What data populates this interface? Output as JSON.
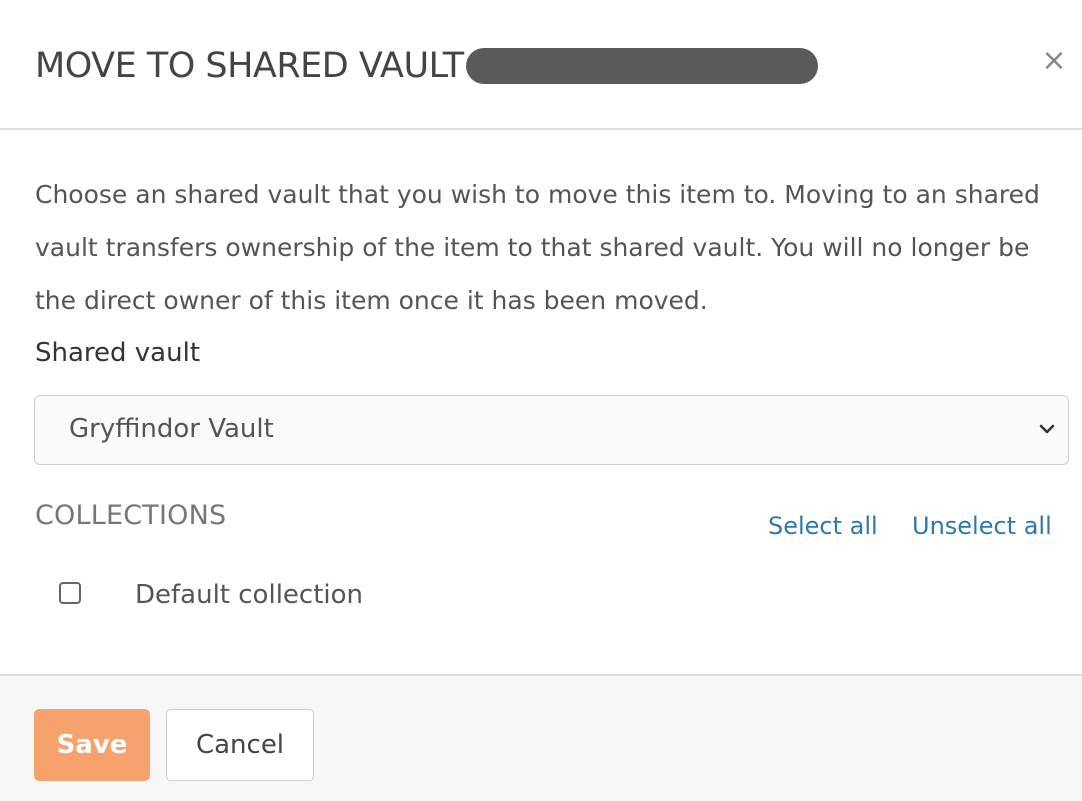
{
  "dialog": {
    "title": "MOVE TO SHARED VAULT",
    "close_label": "×"
  },
  "body": {
    "description": "Choose an shared vault that you wish to move this item to. Moving to an shared vault transfers ownership of the item to that shared vault. You will no longer be the direct owner of this item once it has been moved.",
    "shared_vault_label": "Shared vault",
    "shared_vault_selected": "Gryffindor Vault",
    "collections_heading": "COLLECTIONS",
    "select_all_label": "Select all",
    "unselect_all_label": "Unselect all",
    "collections": [
      {
        "label": "Default collection",
        "checked": false
      }
    ]
  },
  "footer": {
    "save_label": "Save",
    "cancel_label": "Cancel"
  },
  "colors": {
    "accent_save": "#f7a26c",
    "link": "#2a7ab0"
  },
  "icons": {
    "close": "close-icon",
    "dropdown": "chevron-down-icon"
  }
}
